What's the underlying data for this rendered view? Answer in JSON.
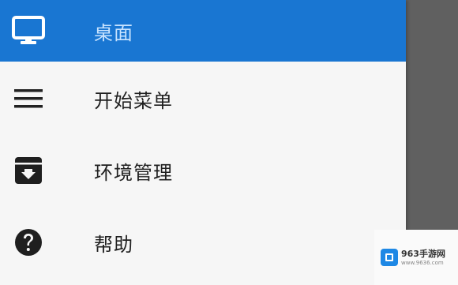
{
  "drawer": {
    "items": [
      {
        "label": "桌面",
        "icon": "monitor-icon",
        "active": true
      },
      {
        "label": "开始菜单",
        "icon": "menu-icon",
        "active": false
      },
      {
        "label": "环境管理",
        "icon": "archive-icon",
        "active": false
      },
      {
        "label": "帮助",
        "icon": "help-icon",
        "active": false
      }
    ]
  },
  "watermark": {
    "title": "963手游网",
    "url": "www.9636.com"
  },
  "colors": {
    "accent": "#1976d2",
    "active_label": "#c9e4ff",
    "drawer_bg": "#f6f6f6",
    "backdrop": "#606060"
  }
}
